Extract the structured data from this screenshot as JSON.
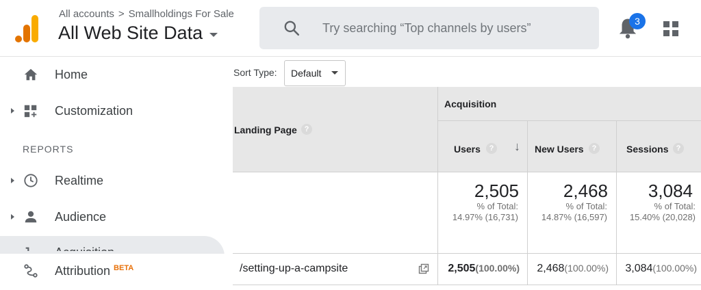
{
  "header": {
    "breadcrumb": {
      "parent": "All accounts",
      "separator": ">",
      "property": "Smallholdings For Sale"
    },
    "view_name": "All Web Site Data",
    "search_placeholder": "Try searching “Top channels by users”",
    "notification_count": "3",
    "icons": {
      "logo": "analytics-logo",
      "search": "search-icon",
      "bell": "notifications-icon",
      "apps": "apps-grid-icon"
    }
  },
  "sidebar": {
    "items": [
      {
        "label": "Home",
        "icon": "home-icon"
      },
      {
        "label": "Customization",
        "icon": "customization-icon"
      },
      {
        "label": "Realtime",
        "icon": "clock-icon"
      },
      {
        "label": "Audience",
        "icon": "person-icon"
      },
      {
        "label": "Acquisition",
        "icon": "acquisition-icon"
      },
      {
        "label": "Attribution",
        "icon": "attribution-icon",
        "badge": "BETA"
      }
    ],
    "section_label": "REPORTS"
  },
  "report": {
    "sort_label": "Sort Type:",
    "sort_value": "Default",
    "group_header": "Acquisition",
    "columns": {
      "dimension": "Landing Page",
      "users": "Users",
      "new_users": "New Users",
      "sessions": "Sessions"
    },
    "help_glyph": "?",
    "sort_arrow": "↓",
    "totals": {
      "users": {
        "value": "2,505",
        "pct_label": "% of Total:",
        "pct": "14.97% (16,731)"
      },
      "new_users": {
        "value": "2,468",
        "pct_label": "% of Total:",
        "pct": "14.87% (16,597)"
      },
      "sessions": {
        "value": "3,084",
        "pct_label": "% of Total:",
        "pct": "15.40% (20,028)"
      }
    },
    "rows": [
      {
        "landing_page": "/setting-up-a-campsite",
        "users": "2,505",
        "users_pct": "(100.00%)",
        "new_users": "2,468",
        "new_users_pct": "(100.00%)",
        "sessions": "3,084",
        "sessions_pct": "(100.00%)"
      }
    ]
  }
}
